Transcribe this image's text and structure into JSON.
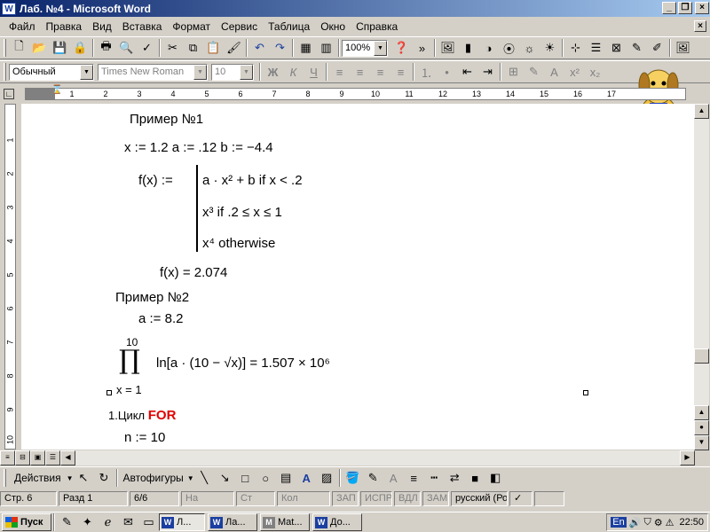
{
  "window": {
    "title": "Лаб. №4 - Microsoft Word"
  },
  "menu": [
    "Файл",
    "Правка",
    "Вид",
    "Вставка",
    "Формат",
    "Сервис",
    "Таблица",
    "Окно",
    "Справка"
  ],
  "toolbar": {
    "zoom": "100%"
  },
  "format_bar": {
    "style": "Обычный",
    "font": "Times New Roman",
    "size": "10"
  },
  "ruler": {
    "numbers": [
      "1",
      "2",
      "3",
      "4",
      "5",
      "6",
      "7",
      "8",
      "9",
      "10",
      "11",
      "12",
      "13",
      "14",
      "15",
      "16",
      "17"
    ]
  },
  "vruler": {
    "numbers": [
      "1",
      "2",
      "3",
      "4",
      "5",
      "6",
      "7",
      "8",
      "9",
      "10"
    ]
  },
  "document": {
    "ex1_title": "Пример №1",
    "ex1_vars": "x := 1.2     a := .12     b := −4.4",
    "fdef_lhs": "f(x) :=",
    "fdef_row1": "a · x² + b   if  x < .2",
    "fdef_row2": "x³   if  .2 ≤ x ≤ 1",
    "fdef_row3": "x⁴   otherwise",
    "fx_result": "f(x) = 2.074",
    "ex2_title": "Пример №2",
    "ex2_var": "a := 8.2",
    "prod_upper": "10",
    "prod_symbol": "∏",
    "prod_lower": "x = 1",
    "prod_expr": "ln[a · (10 − √x)] = 1.507 × 10⁶",
    "cycle_label": "1.Цикл",
    "cycle_keyword": "FOR",
    "n_assign": "n := 10"
  },
  "drawing_bar": {
    "actions": "Действия",
    "autoshapes": "Автофигуры"
  },
  "status": {
    "page": "Стр. 6",
    "section": "Разд 1",
    "pages": "6/6",
    "at": "На",
    "line": "Ст",
    "col": "Кол",
    "rec": "ЗАП",
    "trk": "ИСПР",
    "ext": "ВДЛ",
    "ovr": "ЗАМ",
    "lang": "русский (Ро"
  },
  "taskbar": {
    "start": "Пуск",
    "tasks": [
      "Л...",
      "Ла...",
      "Mat...",
      "До..."
    ],
    "lang": "En",
    "clock": "22:50"
  },
  "colors": {
    "title_start": "#0a246a",
    "title_end": "#a6caf0",
    "keyword": "#e00000"
  }
}
